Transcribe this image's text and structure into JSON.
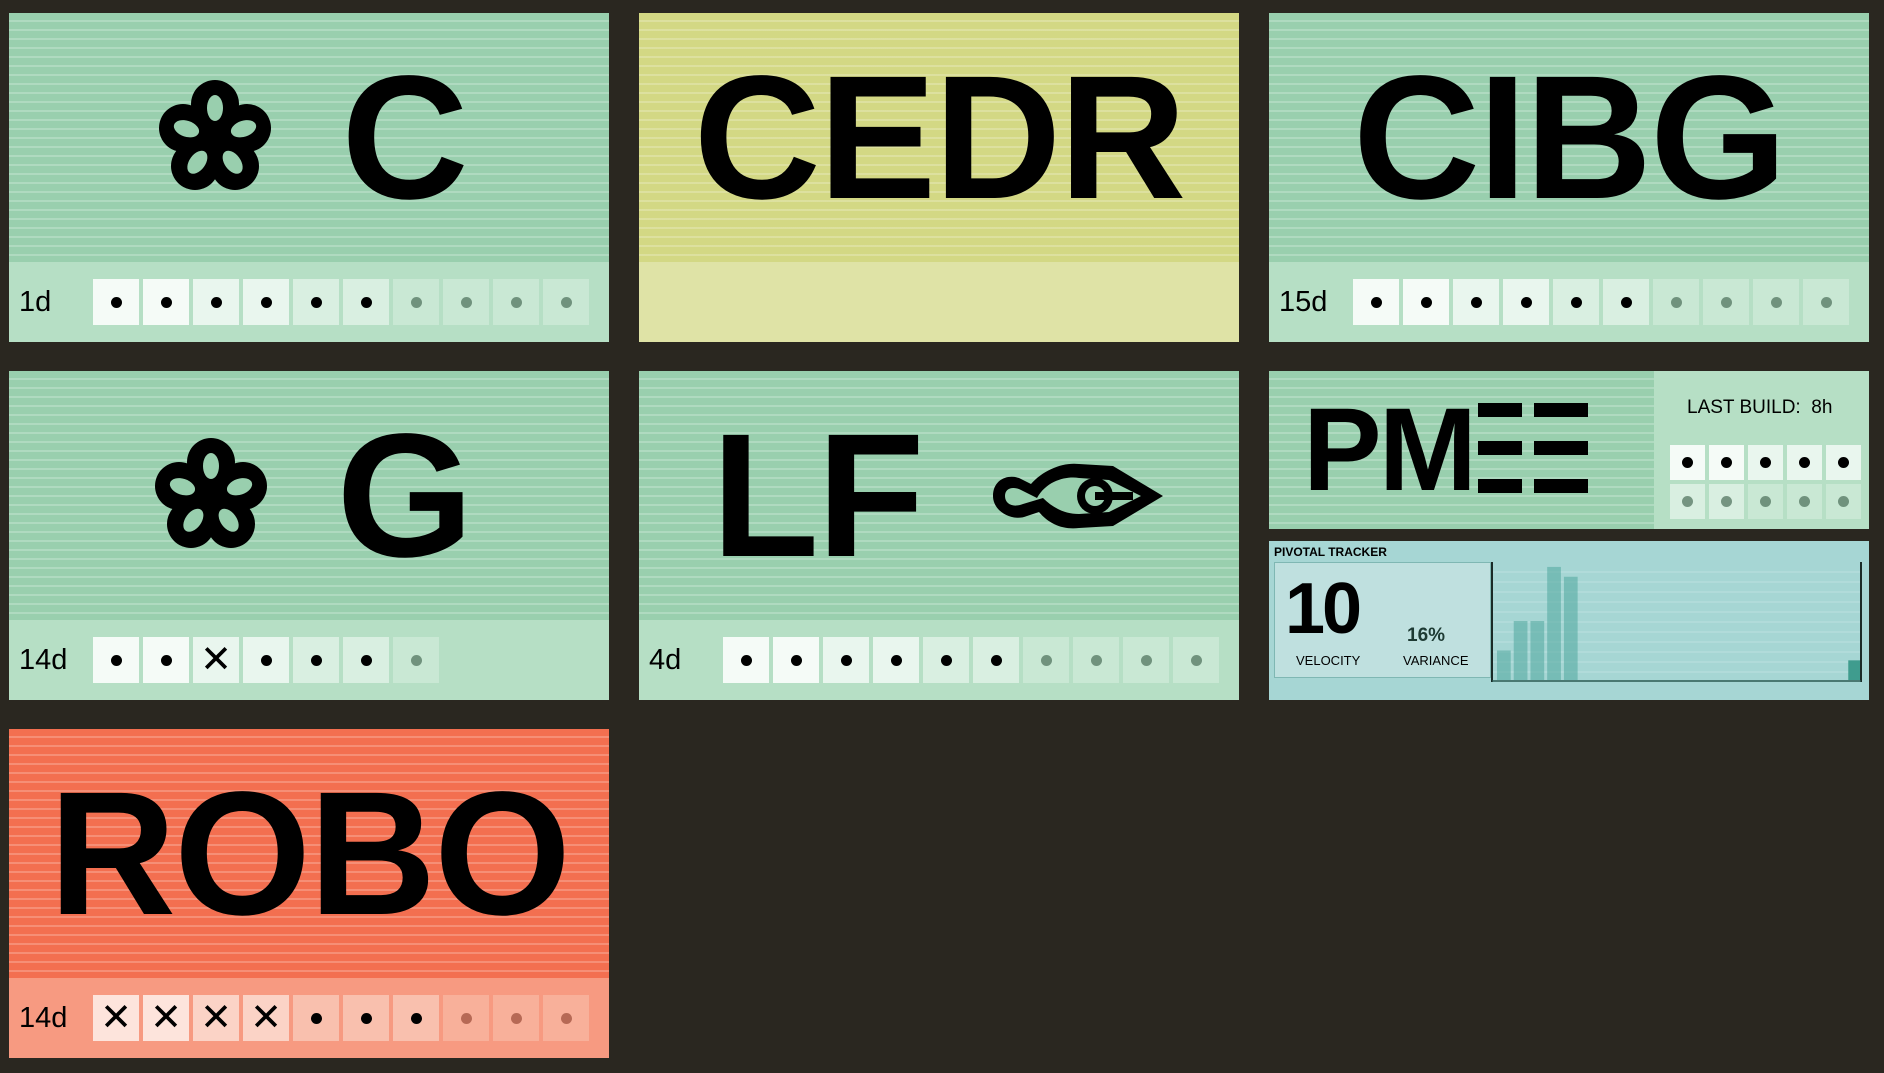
{
  "colors": {
    "background": "#2a2720",
    "success_top": "#99cfae",
    "success_bottom": "#b6dfc5",
    "building_top": "#d3d884",
    "building_bottom": "#dfe3a6",
    "failed_top": "#f36f50",
    "failed_bottom": "#f79a81",
    "tracker": "#a6d6d4"
  },
  "tiles": {
    "c": {
      "label": "C",
      "icon": "flower-icon",
      "age": "1d",
      "builds": [
        "ok",
        "ok",
        "ok",
        "ok",
        "ok",
        "ok",
        "ok",
        "ok",
        "ok",
        "ok"
      ]
    },
    "cedr": {
      "label": "CEDR",
      "status": "building"
    },
    "cibg": {
      "label": "CIBG",
      "age": "15d",
      "builds": [
        "ok",
        "ok",
        "ok",
        "ok",
        "ok",
        "ok",
        "ok",
        "ok",
        "ok",
        "ok"
      ]
    },
    "g": {
      "label": "G",
      "icon": "flower-icon",
      "age": "14d",
      "builds": [
        "ok",
        "ok",
        "fail",
        "ok",
        "ok",
        "ok",
        "ok"
      ]
    },
    "lf": {
      "label": "LF",
      "icon": "dragon-icon",
      "age": "4d",
      "builds": [
        "ok",
        "ok",
        "ok",
        "ok",
        "ok",
        "ok",
        "ok",
        "ok",
        "ok",
        "ok"
      ]
    },
    "pm": {
      "label": "PM",
      "icon": "stripes-icon",
      "last_build_label": "LAST BUILD:",
      "last_build_value": "8h",
      "builds": [
        "ok",
        "ok",
        "ok",
        "ok",
        "ok",
        "ok",
        "ok",
        "ok",
        "ok",
        "ok"
      ]
    },
    "robo": {
      "label": "ROBO",
      "age": "14d",
      "builds": [
        "fail",
        "fail",
        "fail",
        "fail",
        "ok",
        "ok",
        "ok",
        "ok",
        "ok",
        "ok"
      ]
    }
  },
  "tracker": {
    "title": "PIVOTAL TRACKER",
    "velocity": "10",
    "velocity_label": "VELOCITY",
    "variance": "16%",
    "variance_label": "VARIANCE",
    "bars": [
      3,
      6,
      6,
      11.5,
      10.5,
      0,
      0,
      0,
      0,
      0,
      0,
      0,
      0,
      0,
      0,
      0,
      0,
      0,
      0,
      0,
      0,
      2
    ]
  }
}
